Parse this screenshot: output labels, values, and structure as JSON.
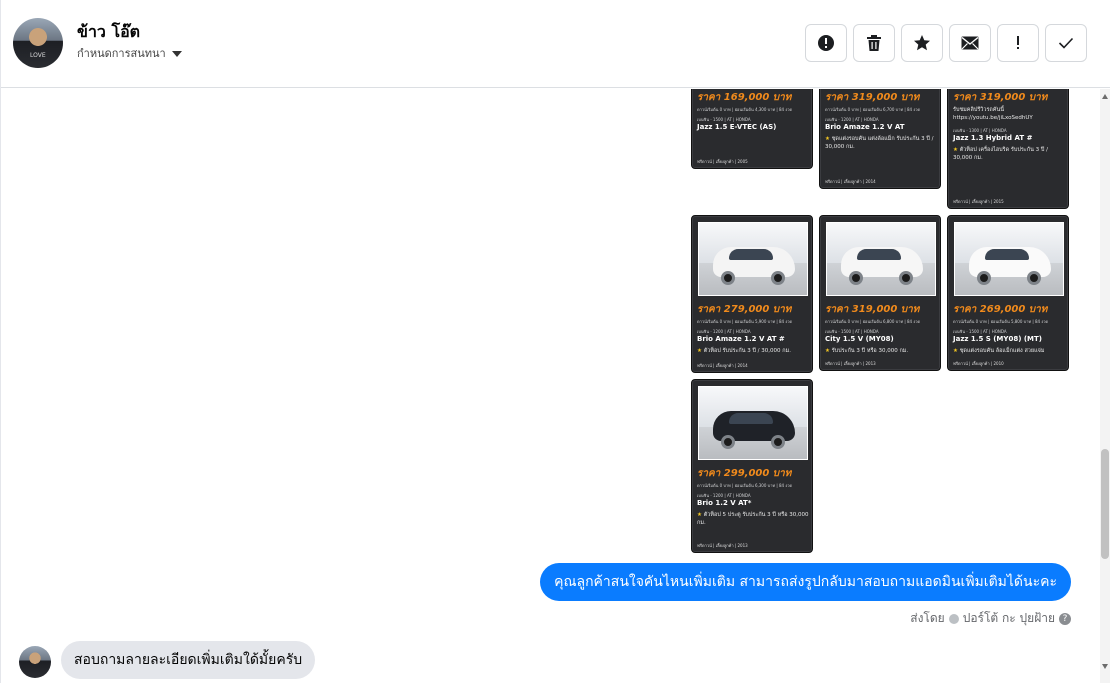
{
  "header": {
    "contact_name": "ข้าว โอ๊ต",
    "assign_label": "กำหนดการสนทนา",
    "avatar_shirt_text": "LOVE"
  },
  "actions": [
    {
      "name": "report-button",
      "icon": "alert-circle-icon"
    },
    {
      "name": "delete-button",
      "icon": "trash-icon"
    },
    {
      "name": "star-button",
      "icon": "star-icon"
    },
    {
      "name": "mark-unread-button",
      "icon": "envelope-icon"
    },
    {
      "name": "follow-up-button",
      "icon": "exclamation-icon"
    },
    {
      "name": "mark-done-button",
      "icon": "check-icon"
    }
  ],
  "cards": [
    {
      "price": "ราคา 169,000 บาท",
      "fine": "ดาวน์เริ่มต้น 0 บาท | ผ่อนเริ่มต้น 4,300 บาท | 84 งวด",
      "spec": "เบนซิน · 1500 | AT | HONDA",
      "model": "Jazz 1.5 E-VTEC (AS)",
      "desc": "",
      "foot": "ฟรีดาวน์ | เลี้ยงลูกค้า | 2005",
      "car_color": "#c8c8c8"
    },
    {
      "price": "ราคา 319,000 บาท",
      "fine": "ดาวน์เริ่มต้น 0 บาท | ผ่อนเริ่มต้น 6,700 บาท | 84 งวด",
      "spec": "เบนซิน · 1200 | AT | HONDA",
      "model": "Brio Amaze 1.2 V AT",
      "desc": "ชุดแต่งรอบคัน แต่งล้อแม็ก รับประกัน 3 ปี / 30,000 กม.",
      "foot": "ฟรีดาวน์ | เลี้ยงลูกค้า | 2014",
      "car_color": "#d9d9d9"
    },
    {
      "price": "ราคา 319,000 บาท",
      "fine": "ดาวน์เริ่มต้น 0 บาท | ผ่อนเริ่มต้น 6,700 บาท | 84 งวด",
      "spec": "เบนซิน · 1300 | AT | HONDA",
      "model": "Jazz 1.3 Hybrid AT #",
      "desc_top": "รับชมคลิปรีวิวรถคันนี้ https://youtu.be/jiLxoSedhUY",
      "desc": "ตัวท็อป เครื่องไฮบริด รับประกัน 3 ปี / 30,000 กม.",
      "foot": "ฟรีดาวน์ | เลี้ยงลูกค้า | 2015",
      "car_color": "#e3e3e3"
    },
    {
      "price": "ราคา 279,000 บาท",
      "fine": "ดาวน์เริ่มต้น 0 บาท | ผ่อนเริ่มต้น 5,900 บาท | 84 งวด",
      "spec": "เบนซิน · 1200 | AT | HONDA",
      "model": "Brio Amaze 1.2 V AT #",
      "desc": "ตัวท็อป รับประกัน 3 ปี / 30,000 กม.",
      "foot": "ฟรีดาวน์ | เลี้ยงลูกค้า | 2014",
      "car_color": "#f4f4f4"
    },
    {
      "price": "ราคา 319,000 บาท",
      "fine": "ดาวน์เริ่มต้น 0 บาท | ผ่อนเริ่มต้น 6,800 บาท | 84 งวด",
      "spec": "เบนซิน · 1500 | AT | HONDA",
      "model": "City 1.5 V (MY08)",
      "desc": "รับประกัน 3 ปี หรือ 30,000 กม.",
      "foot": "ฟรีดาวน์ | เลี้ยงลูกค้า | 2013",
      "car_color": "#f6f6f6"
    },
    {
      "price": "ราคา 269,000 บาท",
      "fine": "ดาวน์เริ่มต้น 0 บาท | ผ่อนเริ่มต้น 5,800 บาท | 84 งวด",
      "spec": "เบนซิน · 1500 | AT | HONDA",
      "model": "Jazz 1.5 S (MY08) (MT)",
      "desc": "ชุดแต่งรอบคัน ล้อแม็กแต่ง สวยแจ่ม",
      "foot": "ฟรีดาวน์ | เลี้ยงลูกค้า | 2010",
      "car_color": "#fafafa"
    },
    {
      "price": "ราคา 299,000 บาท",
      "fine": "ดาวน์เริ่มต้น 0 บาท | ผ่อนเริ่มต้น 6,300 บาท | 84 งวด",
      "spec": "เบนซิน · 1200 | AT | HONDA",
      "model": "Brio 1.2 V AT*",
      "desc": "ตัวท็อป 5 ประตู รับประกัน 3 ปี หรือ 30,000 กม.",
      "foot": "ฟรีดาวน์ | เลี้ยงลูกค้า | 2013",
      "car_color": "#1f2228"
    }
  ],
  "messages": {
    "outgoing_text": "คุณลูกค้าสนใจคันไหนเพิ่มเติม สามารถส่งรูปกลับมาสอบถามแอดมินเพิ่มเติมได้นะคะ",
    "sent_by_label": "ส่งโดย",
    "sent_by_name": "ปอร์โต้ กะ ปุยฝ้าย",
    "incoming_text": "สอบถามลายละเอียดเพิ่มเติมใด้มั้ยครับ"
  },
  "colors": {
    "accent": "#0a7cff",
    "card_bg": "#2a2b2e",
    "price": "#f08a1c"
  }
}
